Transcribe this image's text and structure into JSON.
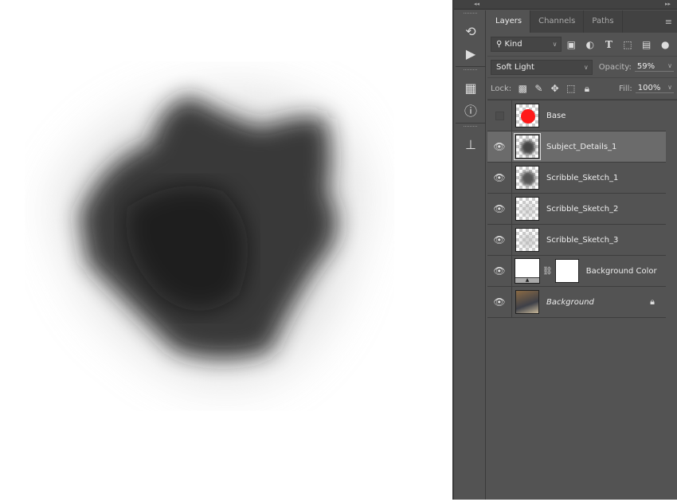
{
  "panel": {
    "tabs": [
      "Layers",
      "Channels",
      "Paths"
    ],
    "active_tab": "Layers",
    "filter": {
      "label": "Kind"
    },
    "blend_mode": "Soft Light",
    "opacity_label": "Opacity:",
    "opacity": "59%",
    "lock_label": "Lock:",
    "fill_label": "Fill:",
    "fill": "100%"
  },
  "layers": [
    {
      "name": "Base",
      "visible": false,
      "thumb": "#ff1a1a"
    },
    {
      "name": "Subject_Details_1",
      "visible": true,
      "selected": true,
      "thumb": "#444"
    },
    {
      "name": "Scribble_Sketch_1",
      "visible": true,
      "thumb": "#555"
    },
    {
      "name": "Scribble_Sketch_2",
      "visible": true,
      "thumb": "#bbb"
    },
    {
      "name": "Scribble_Sketch_3",
      "visible": true,
      "thumb": "#bbb"
    },
    {
      "name": "Background Color",
      "visible": true,
      "fill_layer": true
    },
    {
      "name": "Background",
      "visible": true,
      "locked": true,
      "italic": true,
      "thumb": "#6a5640"
    }
  ]
}
